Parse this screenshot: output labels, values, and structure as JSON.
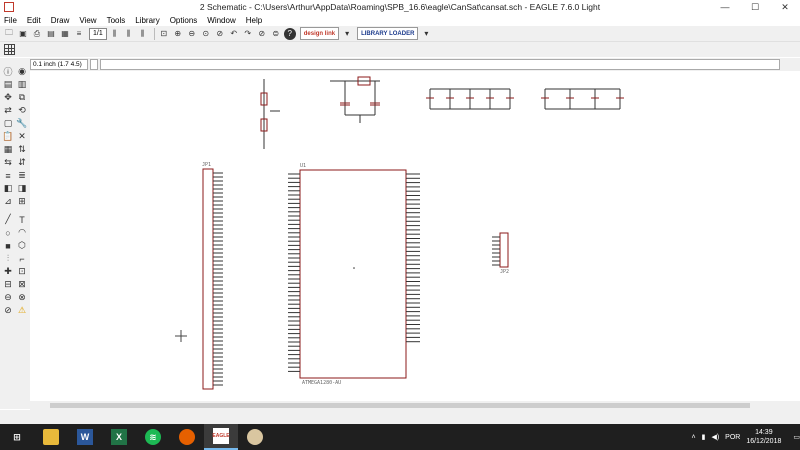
{
  "window": {
    "title": "2 Schematic - C:\\Users\\Arthur\\AppData\\Roaming\\SPB_16.6\\eagle\\CanSat\\cansat.sch - EAGLE 7.6.0 Light",
    "minimize": "—",
    "maximize": "☐",
    "close": "✕"
  },
  "menu": [
    "File",
    "Edit",
    "Draw",
    "View",
    "Tools",
    "Library",
    "Options",
    "Window",
    "Help"
  ],
  "toolbar": {
    "sheet_select": "1/1",
    "designlink_label": "design link",
    "library_label": "LIBRARY LOADER",
    "icons": [
      "open-icon",
      "save-icon",
      "print-icon",
      "cam-icon",
      "board-icon",
      "script-icon",
      "run-icon",
      "zoom-fit-icon",
      "zoom-in-icon",
      "zoom-out-icon",
      "zoom-redraw-icon",
      "zoom-select-icon",
      "undo-icon",
      "redo-icon",
      "stop-icon",
      "go-icon",
      "help-icon"
    ]
  },
  "command": {
    "coordinate": "0.1 inch (1.7 4.5)",
    "input_value": ""
  },
  "schematic": {
    "chip_label_bottom": "ATMEGA1280-AU",
    "chip_name": "U1",
    "connector_left": "JP1",
    "connector_right": "JP2"
  },
  "taskbar": {
    "apps": [
      "windows-start",
      "file-explorer",
      "word",
      "excel",
      "spotify",
      "firefox",
      "eagle",
      "paint"
    ],
    "eagle_label": "EAGLE",
    "language": "POR",
    "time": "14:39",
    "date": "16/12/2018"
  }
}
